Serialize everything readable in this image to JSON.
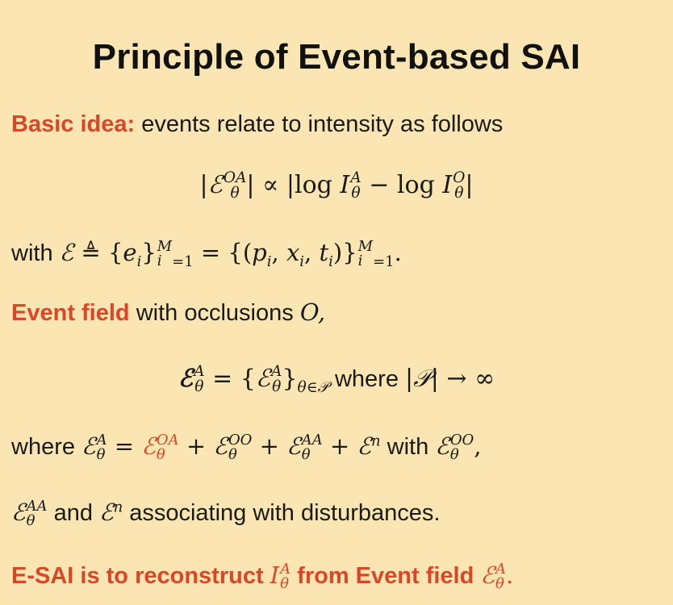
{
  "slide": {
    "title": "Principle of Event-based SAI",
    "basic_idea": {
      "label": "Basic idea:",
      "text": " events relate to intensity as follows"
    },
    "equation1": "|ℰθOA| ∝ |log IθA − log IθO|",
    "with_line": {
      "prefix": "with ",
      "math": "ℰ ≜ {ei}i=1M = {(pi, xi, ti)}i=1M."
    },
    "event_field": {
      "label": "Event field",
      "text": " with occlusions ",
      "symbol": "O,"
    },
    "equation2": {
      "lhs": "ℰθA = {ℰθA}θ∈𝒫",
      "where": " where ",
      "rhs": "|𝒫| → ∞"
    },
    "where_line": {
      "prefix": "where ",
      "math_a": "ℰθA = ",
      "math_red": "ℰθOA",
      "math_b": " + ℰθOO + ℰθAA + ℰn",
      "suffix": " with ",
      "math_c": "ℰθOO,"
    },
    "disturbance_line": {
      "math_a": "ℰθAA",
      "text_a": " and ",
      "math_b": "ℰn",
      "text_b": " associating with disturbances."
    },
    "conclusion": {
      "text_a": "E-SAI is to reconstruct ",
      "math_a": "IθA",
      "text_b": "  from Event field ",
      "math_b": "ℰθA."
    }
  }
}
